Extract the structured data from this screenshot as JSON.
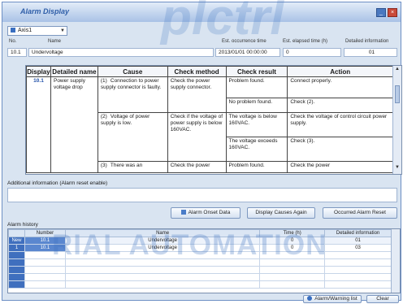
{
  "window": {
    "title": "Alarm Display",
    "min_glyph": "_",
    "close_glyph": "×"
  },
  "axis": {
    "selected": "Axis1",
    "arrow": "▼"
  },
  "header": {
    "labels": {
      "no": "No.",
      "name": "Name",
      "occurrence_time": "Est. occurrence time",
      "elapsed_time": "Est. elapsed time (h)",
      "detailed_info": "Detailed information"
    },
    "values": {
      "no": "10.1",
      "name": "Undervoltage",
      "occurrence_time": "2013/01/01 00:00:00",
      "elapsed_time": "0",
      "detailed_info": "01"
    }
  },
  "cause_table": {
    "columns": [
      "Display",
      "Detailed name",
      "Cause",
      "Check method",
      "Check result",
      "Action"
    ],
    "display": "10.1",
    "detailed_name": "Power supply voltage drop",
    "causes": [
      {
        "idx": "(1)",
        "cause": "Connection to power supply connector is faulty.",
        "check": "Check the power supply connector.",
        "results": [
          {
            "result": "Problem found.",
            "action": "Connect properly."
          },
          {
            "result": "No problem found.",
            "action": "Check (2)."
          }
        ]
      },
      {
        "idx": "(2)",
        "cause": "Voltage of power supply is low.",
        "check": "Check if the voltage of power supply is below 160VAC.",
        "results": [
          {
            "result": "The voltage is below 160VAC.",
            "action": "Check the voltage of control circuit power supply."
          },
          {
            "result": "The voltage exceeds 160VAC.",
            "action": "Check (3)."
          }
        ]
      },
      {
        "idx": "(3)",
        "cause": "There was an",
        "check": "Check the power",
        "results": [
          {
            "result": "Problem found.",
            "action": "Check the power"
          }
        ]
      }
    ]
  },
  "additional_info": {
    "label": "Additional information (Alarm reset enable)"
  },
  "buttons": {
    "onset": "Alarm Onset Data",
    "again": "Display Causes Again",
    "reset": "Occurred Alarm Reset",
    "list": "Alarm/Warning list",
    "clear": "Clear"
  },
  "history": {
    "label": "Alarm history",
    "columns": [
      "",
      "Number",
      "Name",
      "Time (h)",
      "Detailed information"
    ],
    "rows": [
      {
        "row": "New",
        "number": "10.1",
        "name": "Undervoltage",
        "time": "0",
        "detail": "01"
      },
      {
        "row": "1",
        "number": "10.1",
        "name": "Undervoltage",
        "time": "0",
        "detail": "03"
      }
    ]
  },
  "watermark": {
    "top": "plctrl",
    "bottom": "RIAL AUTOMATION"
  },
  "colors": {
    "accent": "#3a6fc0",
    "title": "#2f5ea8",
    "window_bg": "#d9e4f1"
  }
}
